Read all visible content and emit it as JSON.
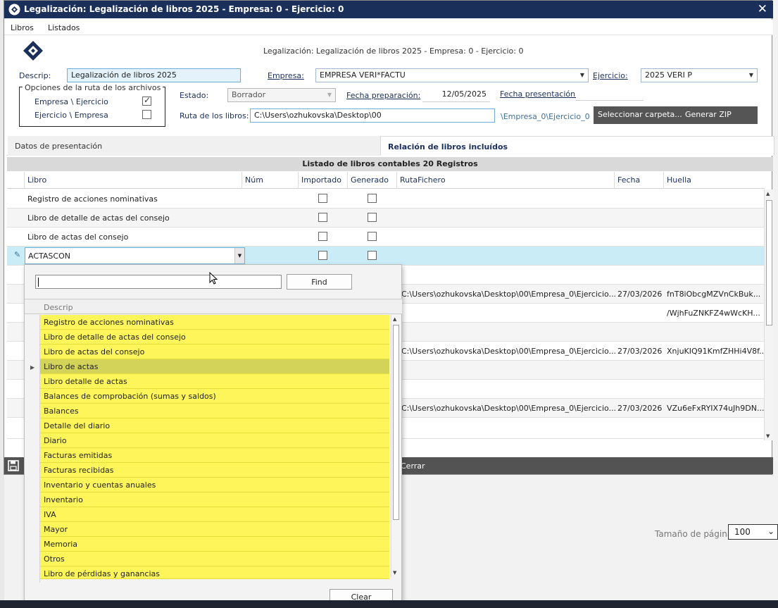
{
  "window": {
    "title": "Legalización: Legalización de libros 2025 - Empresa: 0 - Ejercicio: 0",
    "close_glyph": "✕"
  },
  "menu": {
    "items": [
      "Libros",
      "Listados"
    ]
  },
  "header": {
    "caption": "Legalización: Legalización de libros 2025 - Empresa: 0 - Ejercicio: 0"
  },
  "form": {
    "descrip_label": "Descrip:",
    "descrip_value": "Legalización de libros 2025",
    "empresa_label": "Empresa:",
    "empresa_value": "EMPRESA VERI*FACTU",
    "ejercicio_label": "Ejercicio:",
    "ejercicio_value": "2025 VERI P",
    "group_title": "Opciones de la ruta de los archivos",
    "opt1_label": "Empresa \\ Ejercicio",
    "opt1_checked": true,
    "opt2_label": "Ejercicio \\ Empresa",
    "opt2_checked": false,
    "estado_label": "Estado:",
    "estado_value": "Borrador",
    "fecha_prep_label": "Fecha preparación:",
    "fecha_prep_value": "12/05/2025",
    "fecha_pres_label": "Fecha presentación:",
    "fecha_pres_value": "",
    "ruta_label": "Ruta de los libros:",
    "ruta_value": "C:\\Users\\ozhukovska\\Desktop\\00",
    "ruta_suffix": "\\Empresa_0\\Ejercicio_0",
    "select_folder_button": "Seleccionar carpeta...",
    "zip_button": "Generar ZIP"
  },
  "tabs": [
    "Datos de presentación",
    "Relación de libros incluídos"
  ],
  "grid": {
    "title": "Listado de libros contables 20 Registros",
    "columns": [
      "Libro",
      "Núm",
      "Importado",
      "Generado",
      "RutaFichero",
      "Fecha",
      "Huella"
    ],
    "rows": [
      {
        "libro": "Registro de acciones nominativas",
        "ruta": "",
        "fecha": "",
        "huella": ""
      },
      {
        "libro": "Libro de detalle de actas del consejo",
        "ruta": "",
        "fecha": "",
        "huella": ""
      },
      {
        "libro": "Libro de actas del consejo",
        "ruta": "",
        "fecha": "",
        "huella": ""
      },
      {
        "libro": "ACTASCON",
        "ruta": "",
        "fecha": "",
        "huella": ""
      },
      {
        "libro": "",
        "ruta": "",
        "fecha": "",
        "huella": ""
      },
      {
        "libro": "",
        "ruta": "C:\\Users\\ozhukovska\\Desktop\\00\\Empresa_0\\Ejercicio...",
        "fecha": "27/03/2026",
        "huella": "fnT8iObcgMZVnCkBuk..."
      },
      {
        "libro": "",
        "ruta": "",
        "fecha": "",
        "huella": "/WjhFuZNKFZ4wWcKH..."
      },
      {
        "libro": "",
        "ruta": "",
        "fecha": "",
        "huella": ""
      },
      {
        "libro": "",
        "ruta": "C:\\Users\\ozhukovska\\Desktop\\00\\Empresa_0\\Ejercicio...",
        "fecha": "27/03/2026",
        "huella": "XnjuKIQ91KmfZHHi4V8f..."
      },
      {
        "libro": "",
        "ruta": "",
        "fecha": "",
        "huella": ""
      },
      {
        "libro": "",
        "ruta": "",
        "fecha": "",
        "huella": ""
      },
      {
        "libro": "",
        "ruta": "C:\\Users\\ozhukovska\\Desktop\\00\\Empresa_0\\Ejercicio...",
        "fecha": "27/03/2026",
        "huella": "VZu6eFxRYIX74uJh9DN..."
      },
      {
        "libro": "",
        "ruta": "",
        "fecha": "",
        "huella": ""
      }
    ]
  },
  "footer": {
    "cerrar_label": "Cerrar"
  },
  "popup": {
    "search_value": "",
    "find_button": "Find",
    "column_header": "Descrip",
    "items": [
      "Registro de acciones nominativas",
      "Libro de detalle de actas del consejo",
      "Libro de actas del consejo",
      "Libro de actas",
      "Libro detalle de actas",
      "Balances de comprobación (sumas y saldos)",
      "Balances",
      "Detalle del diario",
      "Diario",
      "Facturas emitidas",
      "Facturas recibidas",
      "Inventario y cuentas anuales",
      "Inventario",
      "IVA",
      "Mayor",
      "Memoria",
      "Otros",
      "Libro de pérdidas y ganancias"
    ],
    "highlighted_index": 3,
    "clear_button": "Clear"
  },
  "pager": {
    "label": "Tamaño de página",
    "value": "100"
  },
  "colors": {
    "titlebar": "#1b2f5b",
    "selected_row": "#c9ecf7",
    "popup_item": "#fdf55a",
    "popup_item_hl": "#d3d35a"
  }
}
